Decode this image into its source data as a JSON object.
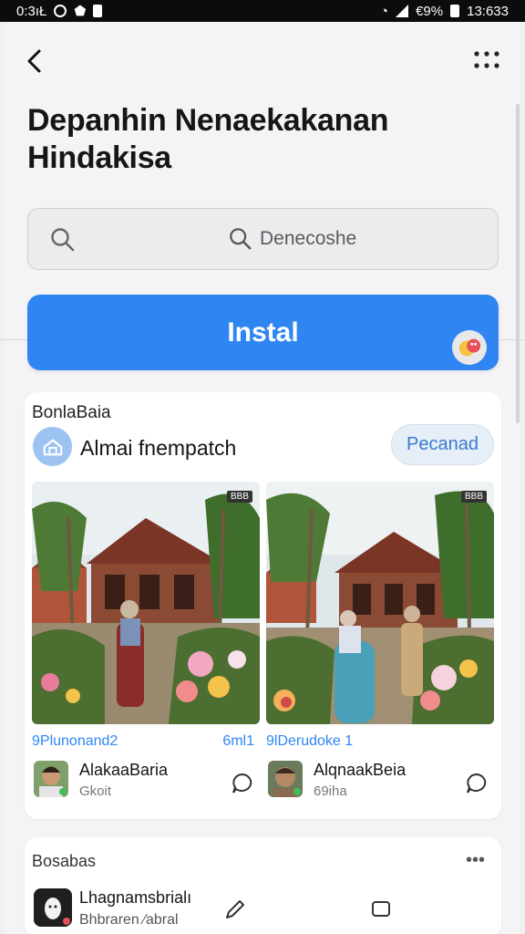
{
  "status_bar": {
    "time_left": "0:3ıŁ",
    "battery_pct": "€9%",
    "time_right": "13:633"
  },
  "header": {
    "title": "Depanhin Nenaekakanan Hindakisa"
  },
  "search": {
    "placeholder": "Denecoshe"
  },
  "install": {
    "label": "Instal"
  },
  "featured": {
    "section_label": "BonlaBaia",
    "app_name": "Almai fnempatch",
    "open_label": "Pecanad",
    "posts": [
      {
        "photo_badge": "BBB",
        "caption_left": "9Plunonand2",
        "caption_right": "6ml1",
        "user": "AlakaaBaria",
        "sub": "Gkoit"
      },
      {
        "photo_badge": "BBB",
        "caption_left": "9lDerudoke 1",
        "caption_right": "",
        "user": "AlqnaakBeia",
        "sub": "69iha"
      }
    ]
  },
  "second": {
    "section_label": "Bosabas",
    "user": "Lhagnamsbrialı",
    "sub": "Bhbraren ∕abral"
  },
  "colors": {
    "accent": "#2f86f2",
    "icon_bg": "#9cc3f2"
  }
}
